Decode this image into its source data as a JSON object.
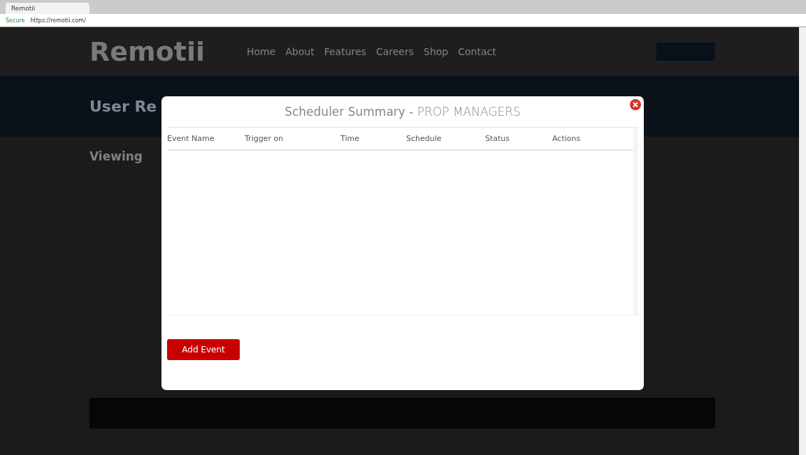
{
  "browser": {
    "tab_title": "Remotii",
    "secure_label": "Secure",
    "url": "https://remotii.com/"
  },
  "site": {
    "logo": "Remotii",
    "nav": [
      "Home",
      "About",
      "Features",
      "Careers",
      "Shop",
      "Contact"
    ],
    "banner_title": "User Re",
    "section_title": "Viewing"
  },
  "modal": {
    "title": "**Scheduler Summary -** PROP MANAGERS",
    "columns": [
      "Event Name",
      "Trigger on",
      "Time",
      "Schedule",
      "Status",
      "Actions"
    ],
    "add_button": "Add Event"
  }
}
